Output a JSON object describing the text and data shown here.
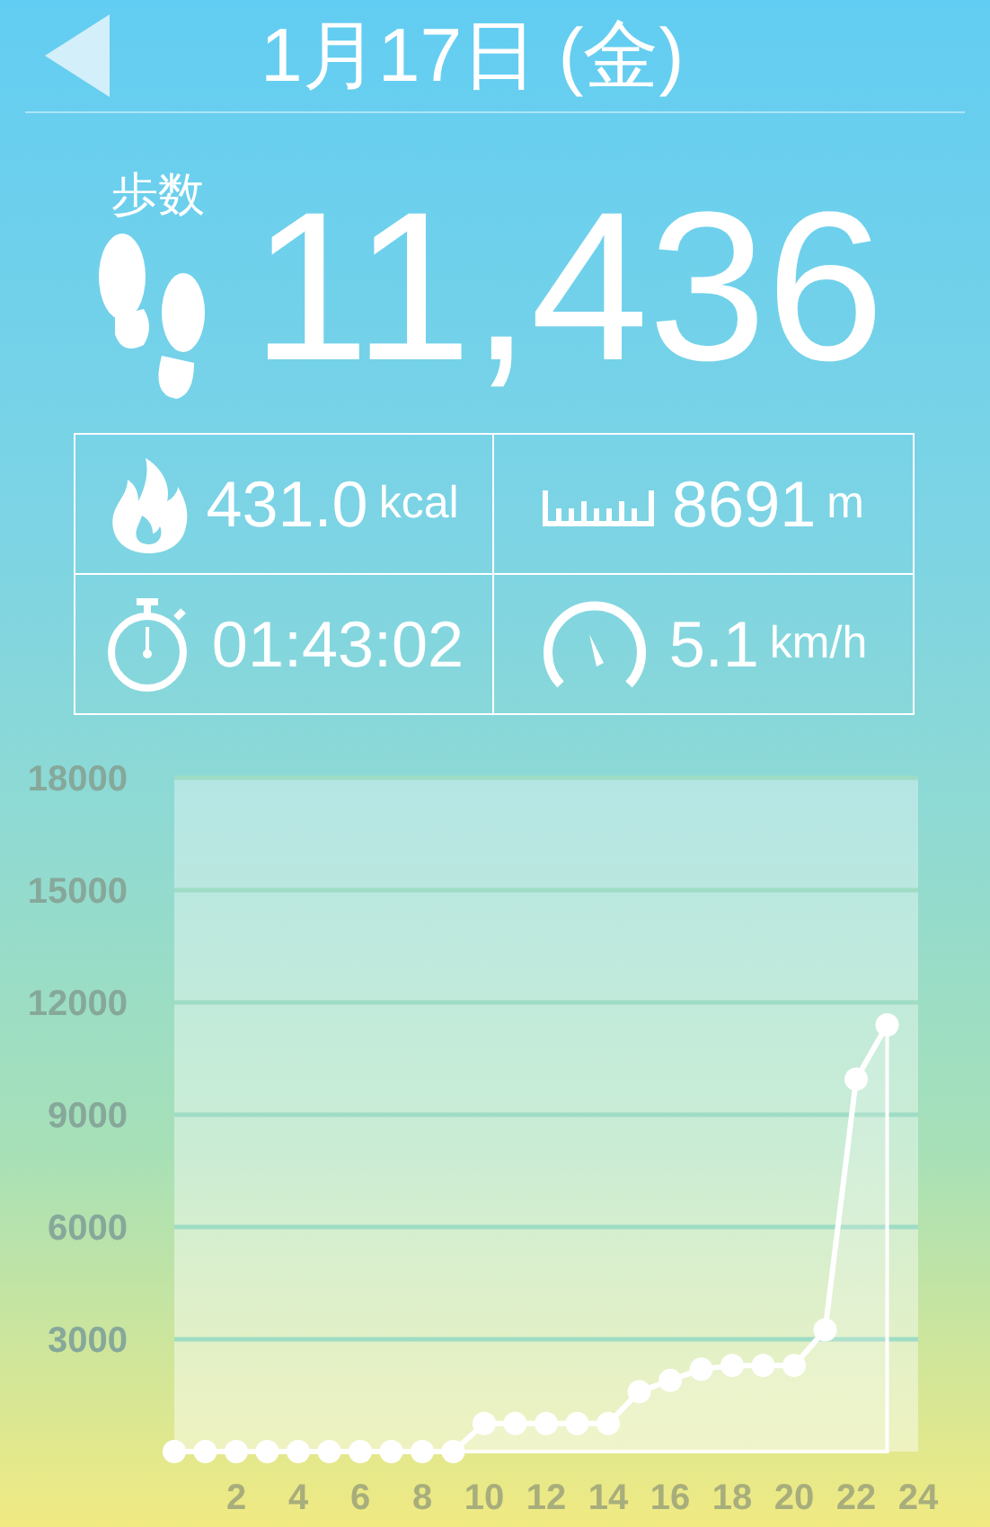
{
  "header": {
    "title": "1月17日 (金)"
  },
  "steps": {
    "label": "歩数",
    "value": "11,436"
  },
  "stats": [
    {
      "kind": "calories",
      "value": "431.0",
      "unit": "kcal"
    },
    {
      "kind": "distance",
      "value": "8691",
      "unit": "m"
    },
    {
      "kind": "duration",
      "value": "01:43:02"
    },
    {
      "kind": "speed",
      "value": "5.1",
      "unit": "km/h"
    }
  ],
  "chart_data": {
    "type": "area",
    "x": [
      0,
      1,
      2,
      3,
      4,
      5,
      6,
      7,
      8,
      9,
      10,
      11,
      12,
      13,
      14,
      15,
      16,
      17,
      18,
      19,
      20,
      21,
      22,
      23
    ],
    "series": [
      {
        "color": "#ffffff",
        "values": [
          0,
          0,
          0,
          0,
          0,
          0,
          0,
          0,
          0,
          0,
          750,
          750,
          750,
          750,
          750,
          1600,
          1900,
          2200,
          2300,
          2300,
          2300,
          3250,
          9950,
          11400
        ]
      }
    ],
    "grid": true,
    "xlim": [
      0,
      24
    ],
    "ylim": [
      0,
      18000
    ],
    "xticks": [
      2,
      4,
      6,
      8,
      10,
      12,
      14,
      16,
      18,
      20,
      22,
      24
    ],
    "yticks": [
      3000,
      6000,
      9000,
      12000,
      15000,
      18000
    ]
  }
}
